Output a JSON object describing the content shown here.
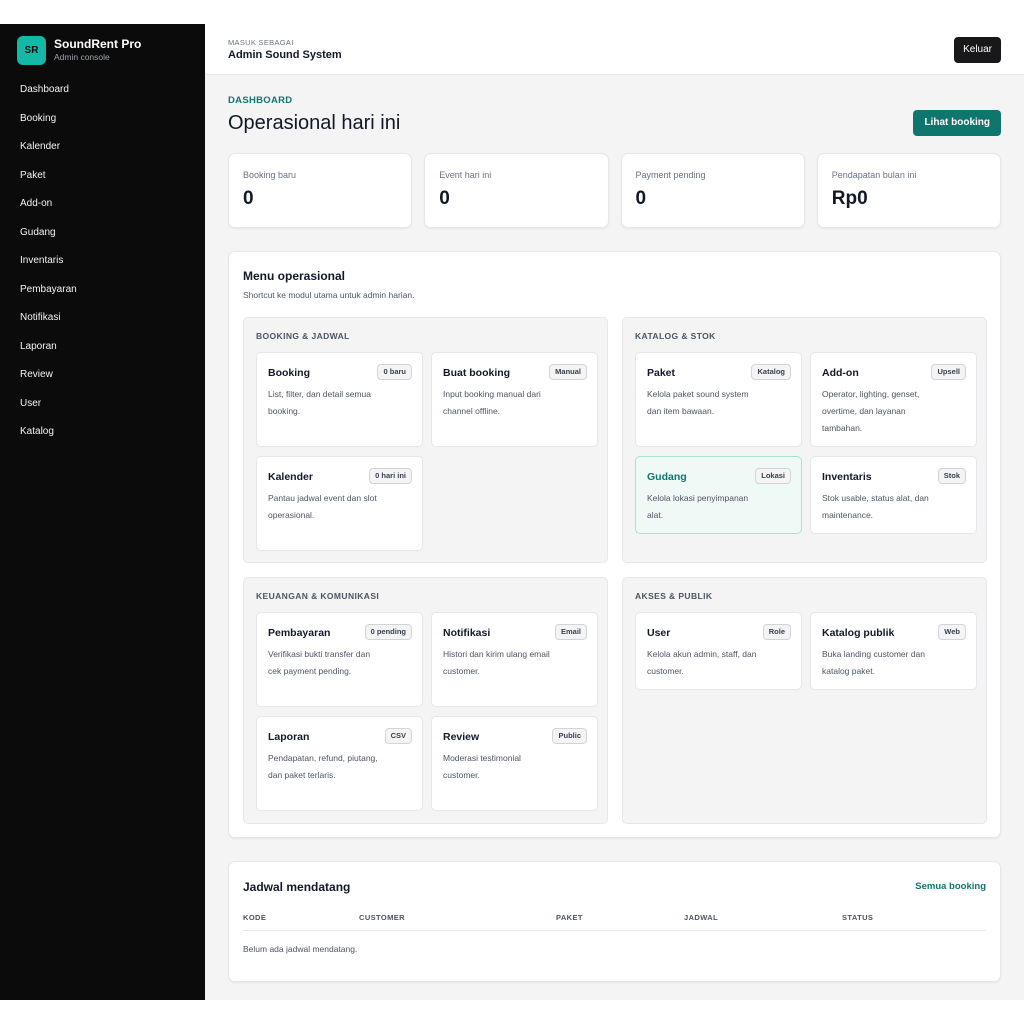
{
  "brand": {
    "initials": "SR",
    "name": "SoundRent Pro",
    "subtitle": "Admin console"
  },
  "sidebar": {
    "items": [
      {
        "label": "Dashboard"
      },
      {
        "label": "Booking"
      },
      {
        "label": "Kalender"
      },
      {
        "label": "Paket"
      },
      {
        "label": "Add-on"
      },
      {
        "label": "Gudang"
      },
      {
        "label": "Inventaris"
      },
      {
        "label": "Pembayaran"
      },
      {
        "label": "Notifikasi"
      },
      {
        "label": "Laporan"
      },
      {
        "label": "Review"
      },
      {
        "label": "User"
      },
      {
        "label": "Katalog"
      }
    ]
  },
  "topbar": {
    "kicker": "MASUK SEBAGAI",
    "user": "Admin Sound System",
    "logout_label": "Keluar"
  },
  "page": {
    "kicker": "DASHBOARD",
    "title": "Operasional hari ini",
    "primary_action": "Lihat booking"
  },
  "stats": [
    {
      "label": "Booking baru",
      "value": "0"
    },
    {
      "label": "Event hari ini",
      "value": "0"
    },
    {
      "label": "Payment pending",
      "value": "0"
    },
    {
      "label": "Pendapatan bulan ini",
      "value": "Rp0"
    }
  ],
  "menu": {
    "title": "Menu operasional",
    "subtitle": "Shortcut ke modul utama untuk admin harian.",
    "groups": [
      {
        "title": "BOOKING & JADWAL",
        "cards": [
          {
            "title": "Booking",
            "badge": "0 baru",
            "desc": "List, filter, dan detail semua booking."
          },
          {
            "title": "Buat booking",
            "badge": "Manual",
            "desc": "Input booking manual dari channel offline."
          },
          {
            "title": "Kalender",
            "badge": "0 hari ini",
            "desc": "Pantau jadwal event dan slot operasional."
          }
        ]
      },
      {
        "title": "KATALOG & STOK",
        "cards": [
          {
            "title": "Paket",
            "badge": "Katalog",
            "desc": "Kelola paket sound system dan item bawaan."
          },
          {
            "title": "Add-on",
            "badge": "Upsell",
            "desc": "Operator, lighting, genset, overtime, dan layanan tambahan."
          },
          {
            "title": "Gudang",
            "badge": "Lokasi",
            "desc": "Kelola lokasi penyimpanan alat."
          },
          {
            "title": "Inventaris",
            "badge": "Stok",
            "desc": "Stok usable, status alat, dan maintenance."
          }
        ]
      },
      {
        "title": "KEUANGAN & KOMUNIKASI",
        "cards": [
          {
            "title": "Pembayaran",
            "badge": "0 pending",
            "desc": "Verifikasi bukti transfer dan cek payment pending."
          },
          {
            "title": "Notifikasi",
            "badge": "Email",
            "desc": "Histori dan kirim ulang email customer."
          },
          {
            "title": "Laporan",
            "badge": "CSV",
            "desc": "Pendapatan, refund, piutang, dan paket terlaris."
          },
          {
            "title": "Review",
            "badge": "Public",
            "desc": "Moderasi testimonial customer."
          }
        ]
      },
      {
        "title": "AKSES & PUBLIK",
        "cards": [
          {
            "title": "User",
            "badge": "Role",
            "desc": "Kelola akun admin, staff, dan customer."
          },
          {
            "title": "Katalog publik",
            "badge": "Web",
            "desc": "Buka landing customer dan katalog paket."
          }
        ]
      }
    ]
  },
  "schedule": {
    "title": "Jadwal mendatang",
    "link": "Semua booking",
    "columns": [
      "KODE",
      "CUSTOMER",
      "PAKET",
      "JADWAL",
      "STATUS"
    ],
    "empty": "Belum ada jadwal mendatang."
  }
}
